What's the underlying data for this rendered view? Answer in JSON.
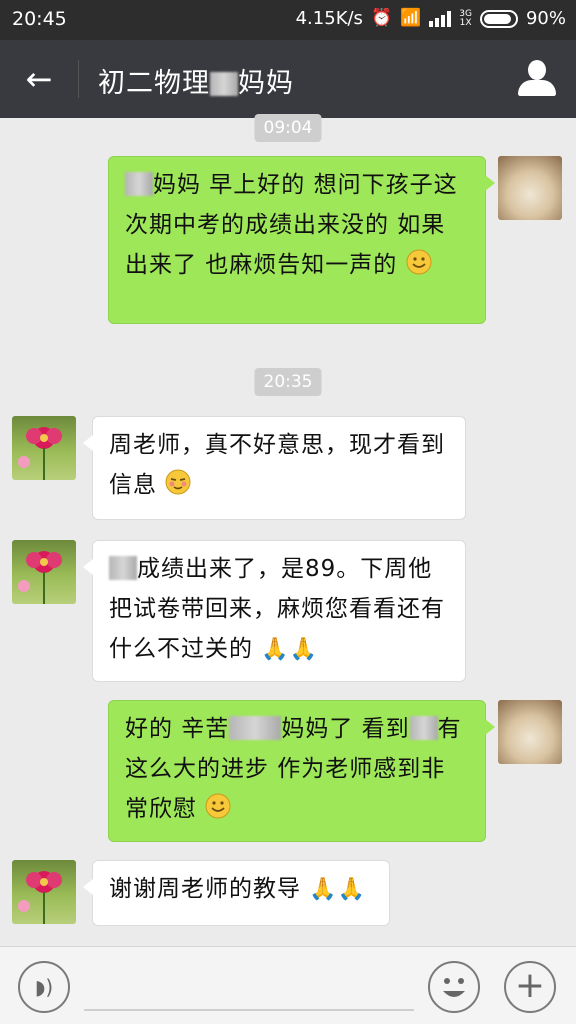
{
  "status_bar": {
    "time": "20:45",
    "speed": "4.15K/s",
    "network_label": "3G\n1X",
    "battery": "90%",
    "icons": [
      "alarm-icon",
      "wifi-icon",
      "signal-icon",
      "battery-icon"
    ]
  },
  "header": {
    "title": "初二物理",
    "title_suffix": "妈妈",
    "back_icon": "back-arrow-icon",
    "profile_icon": "profile-icon"
  },
  "messages": [
    {
      "timestamp": "09:04"
    },
    {
      "side": "right",
      "avatar": "cat-avatar",
      "parts": [
        "",
        "妈妈 早上好的 想问下孩子这次期中考的成绩出来没的 如果出来了 也麻烦告知一声的"
      ],
      "emoji": "smile-emoji"
    },
    {
      "timestamp": "20:35"
    },
    {
      "side": "left",
      "avatar": "flower-avatar",
      "text": "周老师，真不好意思，现才看到信息",
      "emoji": "blush-emoji"
    },
    {
      "side": "left",
      "avatar": "flower-avatar",
      "parts": [
        "",
        "成绩出来了，是89。下周他把试卷带回来，麻烦您看看还有什么不过关的"
      ],
      "emoji": "pray-emoji"
    },
    {
      "side": "right",
      "avatar": "cat-avatar",
      "parts": [
        "好的 辛苦",
        "妈妈了 看到",
        "有这么大的进步 作为老师感到非常欣慰"
      ],
      "emoji": "smile-emoji"
    },
    {
      "side": "left",
      "avatar": "flower-avatar",
      "text": "谢谢周老师的教导",
      "emoji": "pray-emoji"
    }
  ],
  "bottom_bar": {
    "voice_icon": "voice-icon",
    "emoji_icon": "emoji-icon",
    "plus_icon": "plus-icon",
    "plus_glyph": "+"
  }
}
